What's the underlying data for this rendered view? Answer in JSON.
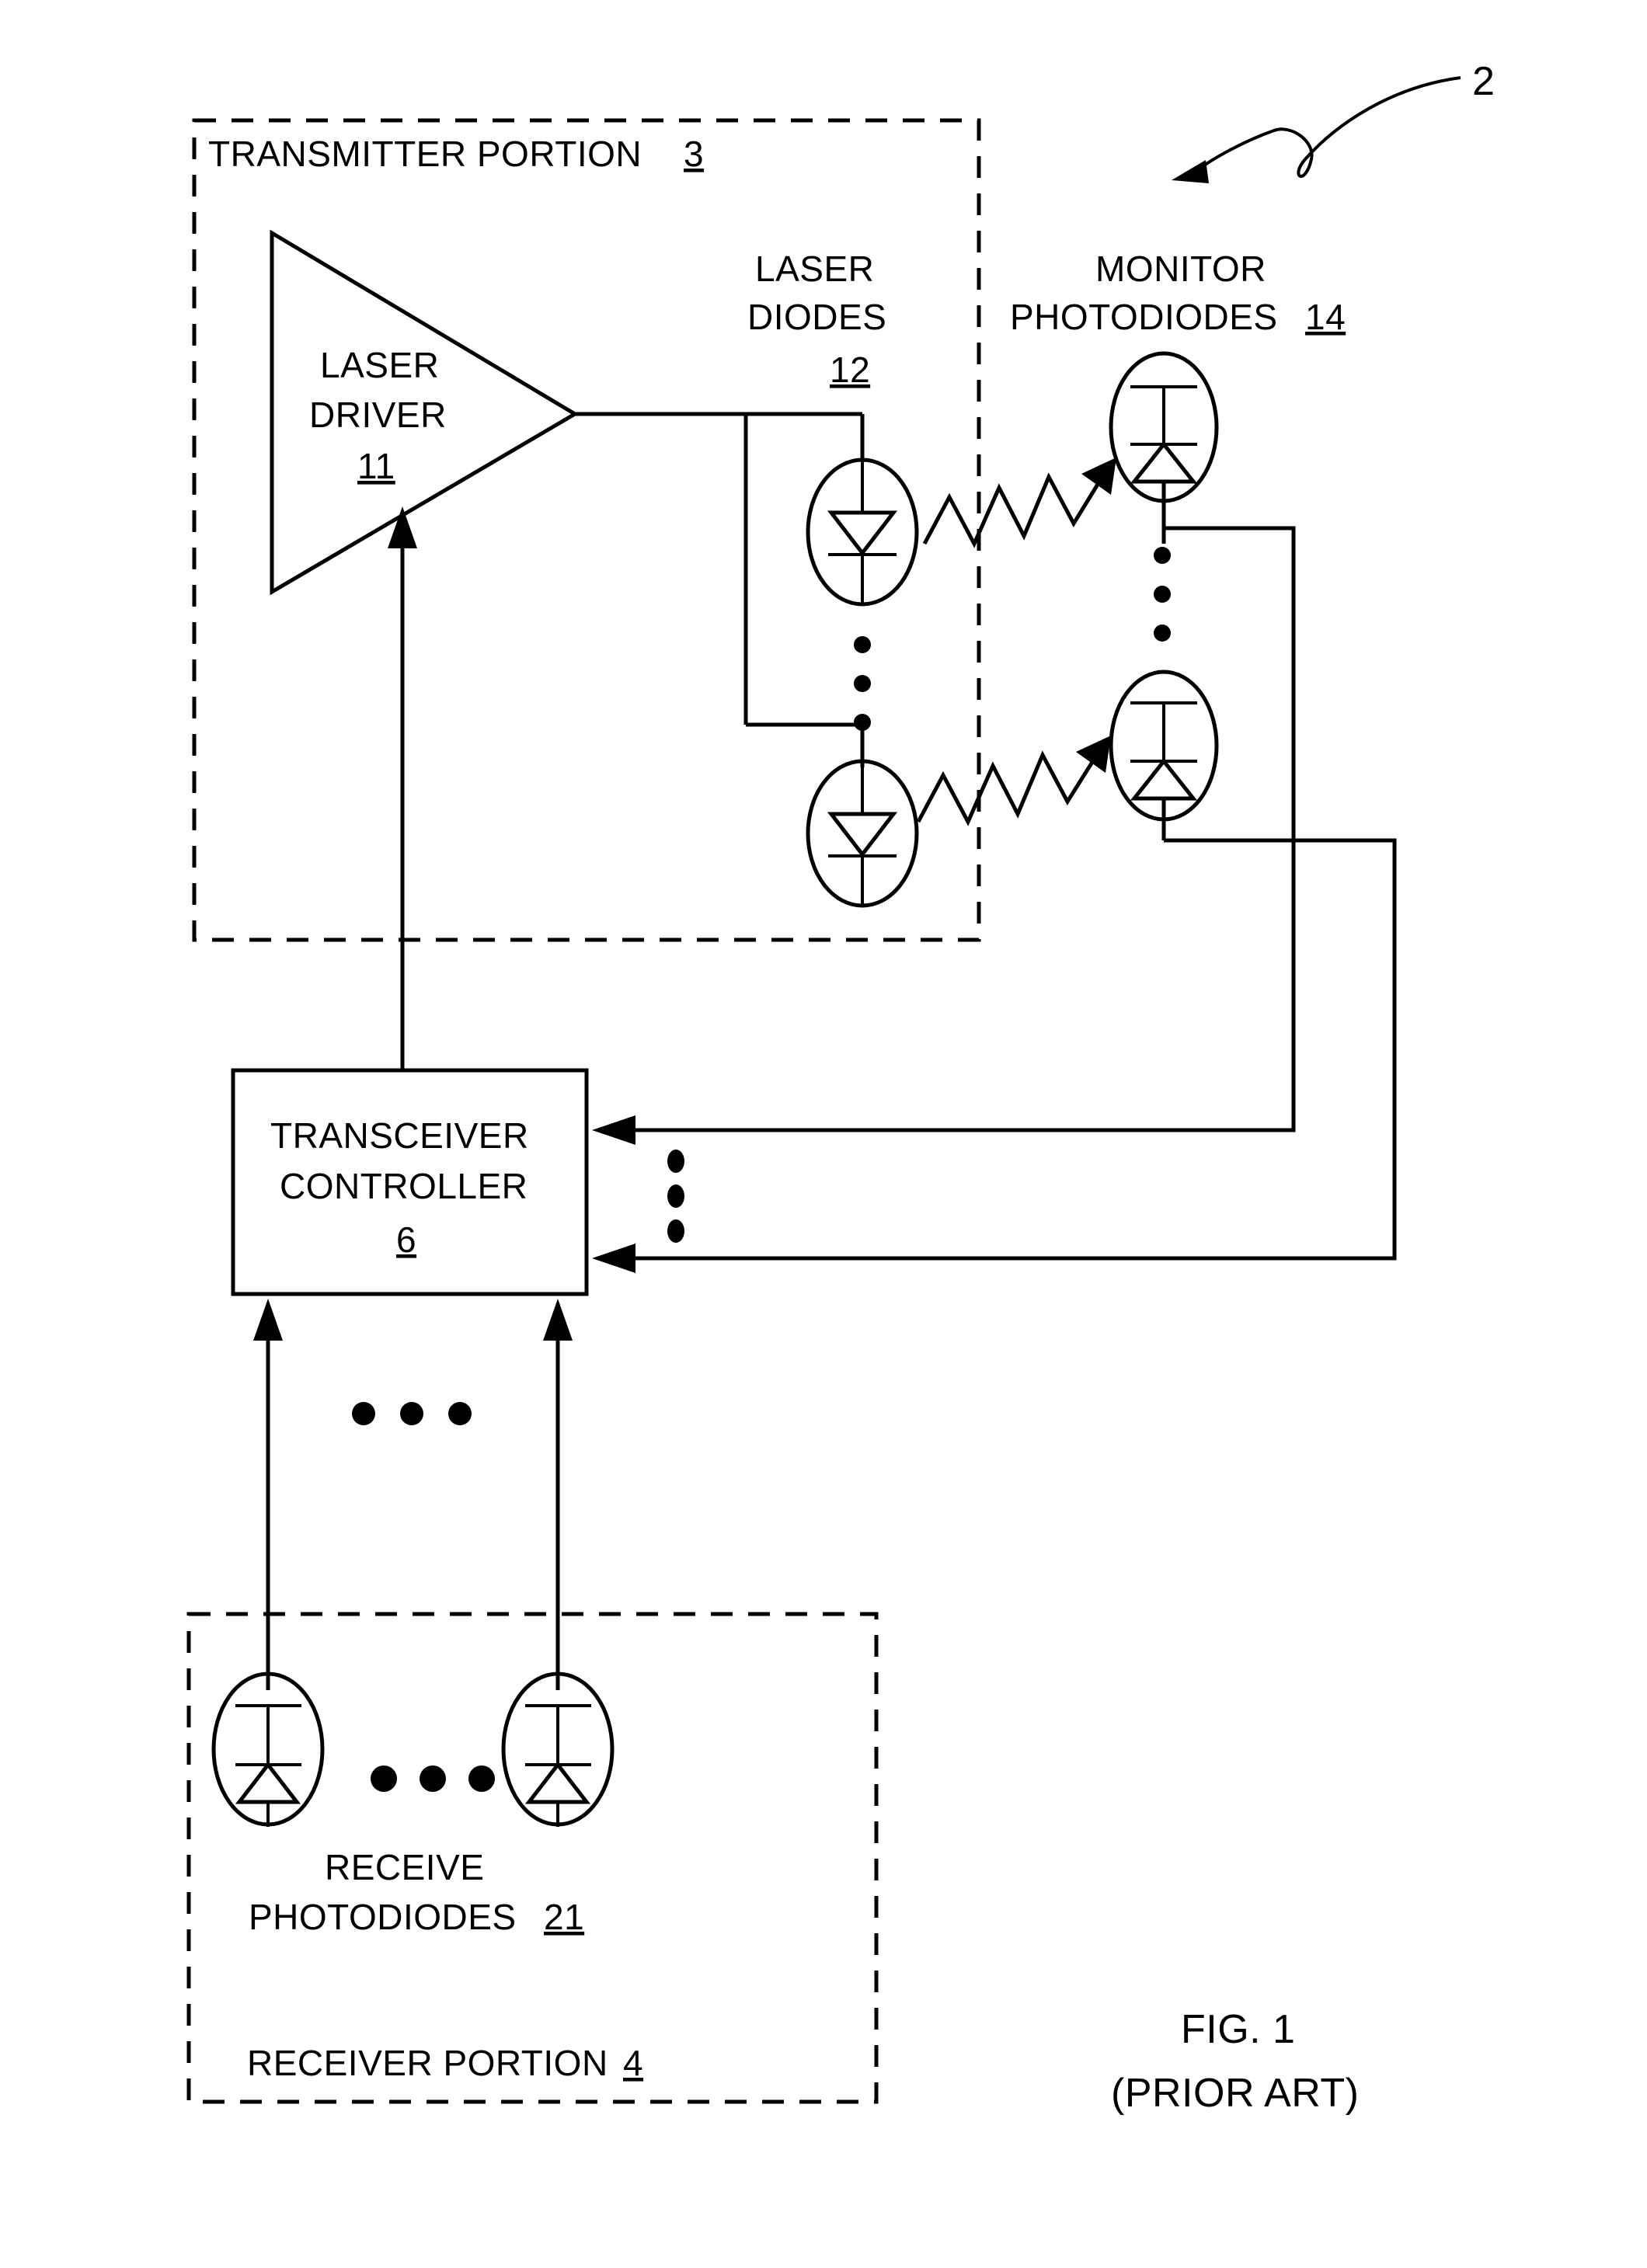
{
  "figure": {
    "caption_line1": "FIG. 1",
    "caption_line2": "(PRIOR ART)",
    "system_reference": "2"
  },
  "transmitter": {
    "label": "TRANSMITTER PORTION",
    "reference": "3"
  },
  "receiver": {
    "label": "RECEIVER PORTION",
    "reference": "4"
  },
  "blocks": {
    "laser_driver": {
      "line1": "LASER",
      "line2": "DRIVER",
      "reference": "11"
    },
    "transceiver_controller": {
      "line1": "TRANSCEIVER",
      "line2": "CONTROLLER",
      "reference": "6"
    }
  },
  "groups": {
    "laser_diodes": {
      "line1": "LASER",
      "line2": "DIODES",
      "reference": "12"
    },
    "monitor_photodiodes": {
      "line1": "MONITOR",
      "line2": "PHOTODIODES",
      "reference": "14"
    },
    "receive_photodiodes": {
      "line1": "RECEIVE",
      "line2": "PHOTODIODES",
      "reference": "21"
    }
  },
  "icons": {
    "laser_diode_symbol": "laser-diode-symbol",
    "photodiode_symbol": "photodiode-symbol",
    "optical_beam": "zigzag-light-beam-arrow",
    "ellipsis_vertical": "vertical-ellipsis",
    "ellipsis_horizontal": "horizontal-ellipsis",
    "lead_line": "curved-lead-arrow"
  },
  "colors": {
    "ink": "#000000",
    "paper": "#ffffff"
  }
}
